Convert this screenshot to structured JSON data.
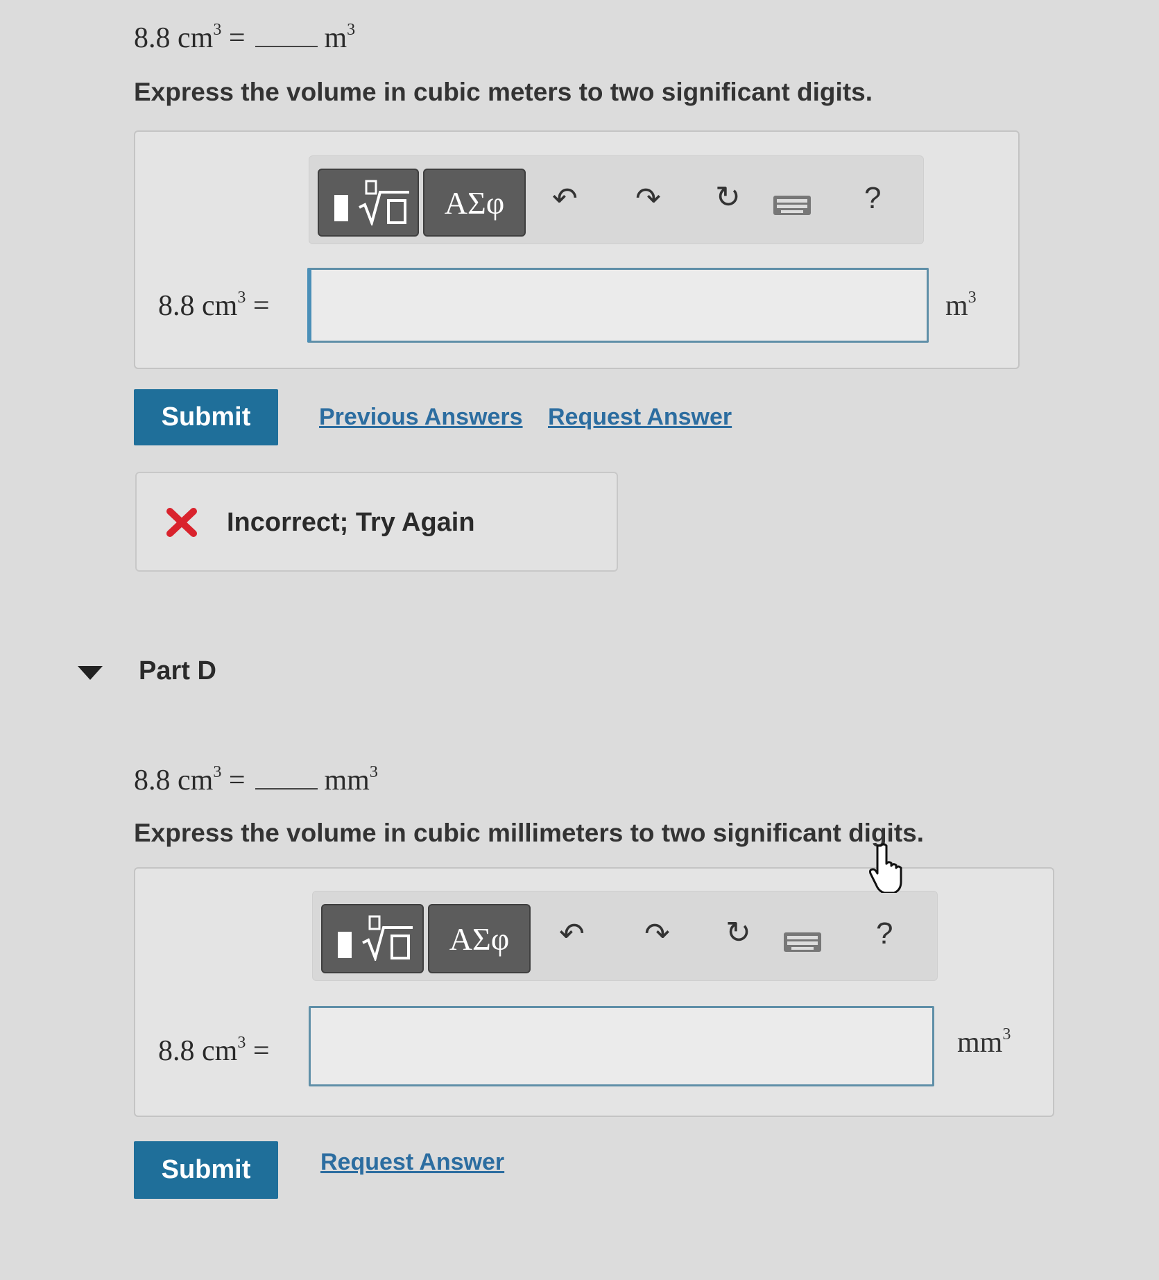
{
  "partC": {
    "question": {
      "lhs": "8.8 cm",
      "lhs_exp": "3",
      "eq": "=",
      "rhs": "m",
      "rhs_exp": "3"
    },
    "instruction": "Express the volume in cubic meters to two significant digits.",
    "toolbar": {
      "templates_label": "",
      "symbols_label": "ΑΣφ",
      "help_label": "?"
    },
    "input": {
      "lhs": "8.8 cm",
      "lhs_exp": "3",
      "eq": "=",
      "value": "",
      "unit": "m",
      "unit_exp": "3"
    },
    "submit_label": "Submit",
    "previous_answers_label": "Previous Answers",
    "request_answer_label": "Request Answer",
    "feedback": {
      "icon": "x-mark-icon",
      "text": "Incorrect; Try Again",
      "color": "#d9232d"
    }
  },
  "partD": {
    "title": "Part D",
    "question": {
      "lhs": "8.8 cm",
      "lhs_exp": "3",
      "eq": "=",
      "rhs": "mm",
      "rhs_exp": "3"
    },
    "instruction": "Express the volume in cubic millimeters to two significant digits.",
    "toolbar": {
      "symbols_label": "ΑΣφ",
      "help_label": "?"
    },
    "input": {
      "lhs": "8.8 cm",
      "lhs_exp": "3",
      "eq": "=",
      "value": "",
      "unit": "mm",
      "unit_exp": "3"
    },
    "submit_label": "Submit",
    "request_answer_label": "Request Answer"
  },
  "colors": {
    "accent": "#1f6f9a",
    "link": "#2c6da0",
    "error": "#d9232d"
  }
}
